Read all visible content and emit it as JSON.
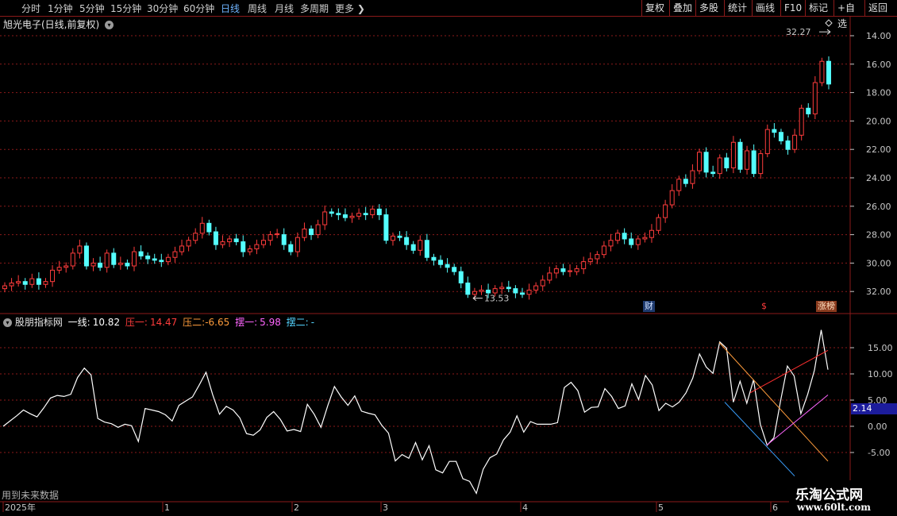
{
  "toolbar": {
    "periods": [
      "分时",
      "1分钟",
      "5分钟",
      "15分钟",
      "30分钟",
      "60分钟",
      "日线",
      "周线",
      "月线",
      "多周期",
      "更多"
    ],
    "active_period": "日线",
    "right_buttons": [
      "复权",
      "叠加",
      "多股",
      "统计",
      "画线",
      "F10",
      "标记",
      "+自选",
      "返回"
    ]
  },
  "stock": {
    "title": "旭光电子(日线,前复权)",
    "high_label": "32.27",
    "low_label": "13.53"
  },
  "price_axis": [
    "32.00",
    "30.00",
    "28.00",
    "26.00",
    "24.00",
    "22.00",
    "20.00",
    "18.00",
    "16.00",
    "14.00"
  ],
  "markers": {
    "cai": "财",
    "dollar": "$",
    "zhangting": "涨榜"
  },
  "indicator": {
    "name": "股朋指标网",
    "line1_label": "一线:",
    "line1_value": "10.82",
    "ya1_label": "压一:",
    "ya1_value": "14.47",
    "ya2_label": "压二:",
    "ya2_value": "-6.65",
    "bai1_label": "摆一:",
    "bai1_value": "5.98",
    "bai2_label": "摆二:",
    "bai2_value": "-",
    "axis": [
      "15.00",
      "10.00",
      "5.00",
      "0.00",
      "-5.00"
    ],
    "current_value": "2.14"
  },
  "footer": {
    "note": "用到未来数据",
    "date_labels": [
      "2025年",
      "1",
      "2",
      "3",
      "4",
      "5",
      "6"
    ]
  },
  "watermark": {
    "name": "乐淘公式网",
    "url": "www.60lt.com"
  },
  "colors": {
    "up": "#ff3c3c",
    "down": "#54ffff",
    "grid": "#8b1a1a",
    "line": "#ffffff"
  },
  "chart_data": [
    {
      "type": "candlestick",
      "title": "旭光电子(日线,前复权)",
      "ylim": [
        13.0,
        33.0
      ],
      "y_ticks": [
        14,
        16,
        18,
        20,
        22,
        24,
        26,
        28,
        30,
        32
      ],
      "x_tick_labels": [
        "2025年",
        "1",
        "2",
        "3",
        "4",
        "5",
        "6"
      ],
      "annotations": [
        {
          "text": "32.27",
          "value": 32.27
        },
        {
          "text": "13.53",
          "value": 13.53
        }
      ],
      "closes": [
        14.4,
        14.6,
        14.7,
        14.5,
        14.9,
        14.5,
        14.7,
        15.5,
        15.7,
        15.8,
        16.7,
        17.2,
        15.8,
        16.0,
        15.7,
        16.7,
        15.9,
        16.0,
        15.8,
        16.8,
        16.5,
        16.3,
        16.2,
        16.1,
        16.4,
        16.8,
        17.2,
        17.6,
        18.1,
        18.8,
        18.2,
        17.3,
        17.5,
        17.7,
        17.5,
        16.8,
        17.0,
        17.3,
        17.6,
        18.0,
        18.0,
        17.3,
        16.8,
        17.8,
        18.4,
        18.0,
        18.7,
        19.6,
        19.5,
        19.4,
        19.2,
        19.3,
        19.5,
        19.4,
        19.8,
        19.4,
        17.6,
        17.9,
        17.8,
        17.3,
        16.9,
        17.6,
        16.4,
        16.2,
        15.9,
        15.7,
        15.4,
        14.6,
        13.8,
        14.0,
        14.1,
        13.9,
        14.2,
        14.3,
        14.2,
        13.9,
        13.8,
        14.1,
        14.4,
        14.8,
        15.3,
        15.6,
        15.4,
        15.4,
        15.6,
        16.1,
        16.3,
        16.6,
        17.2,
        17.6,
        18.1,
        17.7,
        17.3,
        17.7,
        17.8,
        18.3,
        19.2,
        20.1,
        21.1,
        21.9,
        21.6,
        22.5,
        23.8,
        22.4,
        22.3,
        23.4,
        22.7,
        24.5,
        22.6,
        23.9,
        22.3,
        23.7,
        25.4,
        25.2,
        24.6,
        24.0,
        25.0,
        26.9,
        26.5,
        28.7,
        30.2,
        28.6
      ]
    },
    {
      "type": "line",
      "ylim": [
        -10.0,
        20.0
      ],
      "y_ticks": [
        15,
        10,
        5,
        0,
        -5
      ],
      "series": [
        {
          "name": "一线",
          "values": [
            0,
            1,
            2,
            3.1,
            2.4,
            1.8,
            3.5,
            5.4,
            5.9,
            5.7,
            6.1,
            9.3,
            11.1,
            9.8,
            1.5,
            0.8,
            0.5,
            -0.2,
            0.4,
            0.1,
            -2.9,
            3.4,
            3.1,
            2.8,
            2.2,
            1.0,
            4.0,
            4.8,
            5.6,
            7.9,
            10.3,
            6.0,
            2.3,
            3.8,
            3.1,
            1.6,
            -1.4,
            -1.7,
            -0.7,
            1.7,
            2.8,
            1.3,
            -0.9,
            -0.6,
            -1.0,
            4.2,
            2.3,
            -0.2,
            3.9,
            7.6,
            5.6,
            4.0,
            5.8,
            2.9,
            2.5,
            2.2,
            0.2,
            -1.3,
            -6.6,
            -5.4,
            -6.1,
            -3.1,
            -6.4,
            -3.7,
            -8.3,
            -8.9,
            -6.7,
            -6.7,
            -10.0,
            -10.5,
            -12.8,
            -8.2,
            -6.0,
            -5.3,
            -2.6,
            -1.1,
            2.0,
            -1.1,
            0.9,
            0.4,
            0.4,
            0.4,
            0.7,
            7.4,
            8.4,
            6.8,
            2.7,
            3.6,
            3.7,
            7.2,
            5.7,
            3.4,
            3.9,
            8.1,
            5.1,
            9.7,
            7.9,
            3.0,
            4.4,
            3.7,
            4.6,
            6.4,
            9.2,
            13.8,
            11.3,
            10.1,
            16.1,
            14.9,
            4.6,
            8.6,
            4.4,
            8.9,
            0.4,
            -3.6,
            -2.2,
            4.9,
            11.5,
            9.6,
            2.4,
            6.1,
            10.7,
            18.4,
            10.8
          ]
        },
        {
          "name": "压一",
          "values": [
            6.4,
            14.5
          ]
        },
        {
          "name": "压二",
          "values": [
            16.0,
            -6.65
          ]
        },
        {
          "name": "摆一",
          "values": [
            -3.6,
            5.98
          ]
        }
      ]
    }
  ]
}
